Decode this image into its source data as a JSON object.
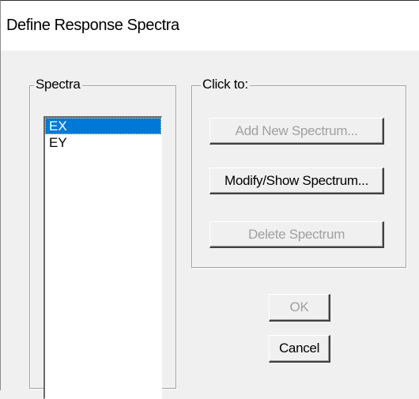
{
  "window": {
    "title": "Define Response Spectra"
  },
  "spectra_group": {
    "legend": "Spectra",
    "items": [
      {
        "label": "EX",
        "selected": true
      },
      {
        "label": "EY",
        "selected": false
      }
    ]
  },
  "actions_group": {
    "legend": "Click to:",
    "add_label": "Add New Spectrum...",
    "add_enabled": false,
    "modify_label": "Modify/Show Spectrum...",
    "modify_enabled": true,
    "delete_label": "Delete Spectrum",
    "delete_enabled": false
  },
  "footer": {
    "ok_label": "OK",
    "ok_enabled": false,
    "cancel_label": "Cancel",
    "cancel_enabled": true
  },
  "colors": {
    "selection": "#0078d7",
    "disabled_text": "#a0a0a0",
    "dialog_background": "#f0f0f0"
  }
}
